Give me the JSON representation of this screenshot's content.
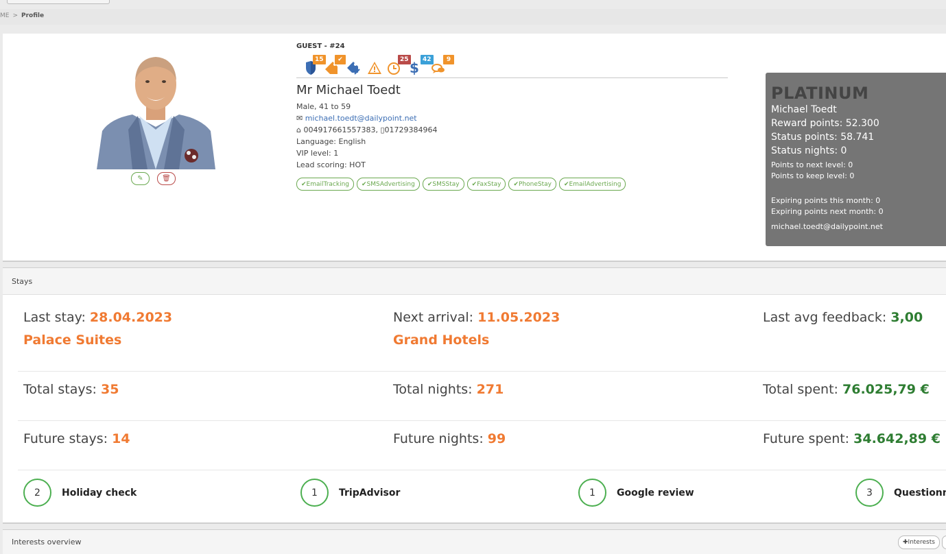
{
  "breadcrumb": {
    "home": "ME",
    "current": "Profile"
  },
  "guest": {
    "id_label": "GUEST - #24",
    "name": "Mr Michael Toedt",
    "gender_age": "Male, 41 to 59",
    "email": "michael.toedt@dailypoint.net",
    "phones": "004917661557383, ",
    "mobile": "01729384964",
    "language": "Language: English",
    "vip": "VIP level: 1",
    "lead": "Lead scoring: HOT"
  },
  "badges": [
    {
      "icon": "shield-icon",
      "count": "",
      "color": "#3c6eb4"
    },
    {
      "icon": "tag-icon",
      "count": "15",
      "color": "#f0932b"
    },
    {
      "icon": "tag-check-icon",
      "count": "✔",
      "color": "#f0932b"
    },
    {
      "icon": "tags-icon",
      "count": "",
      "color": "#3c6eb4"
    },
    {
      "icon": "warning-icon",
      "count": "",
      "color": "#f0932b"
    },
    {
      "icon": "clock-icon",
      "count": "25",
      "color": "#b94a48"
    },
    {
      "icon": "dollar-icon",
      "count": "42",
      "color": "#3aa0d8"
    },
    {
      "icon": "comments-icon",
      "count": "9",
      "color": "#f0932b"
    }
  ],
  "consents": [
    "EmailTracking",
    "SMSAdvertising",
    "SMSStay",
    "FaxStay",
    "PhoneStay",
    "EmailAdvertising"
  ],
  "loyalty": {
    "level": "PLATINUM",
    "name": "Michael Toedt",
    "reward": "Reward points: 52.300",
    "status": "Status points: 58.741",
    "nights": "Status nights: 0",
    "next_level": "Points to next level: 0",
    "keep_level": "Points to keep level: 0",
    "exp_this": "Expiring points this month: 0",
    "exp_next": "Expiring points next month: 0",
    "email": "michael.toedt@dailypoint.net"
  },
  "stays": {
    "title": "Stays",
    "last_stay_label": "Last stay: ",
    "last_stay": "28.04.2023",
    "last_hotel": "Palace Suites",
    "next_arrival_label": "Next arrival: ",
    "next_arrival": "11.05.2023",
    "next_hotel": "Grand Hotels",
    "feedback_label": "Last avg feedback: ",
    "feedback": "3,00",
    "total_stays_label": "Total stays: ",
    "total_stays": "35",
    "total_nights_label": "Total nights: ",
    "total_nights": "271",
    "total_spent_label": "Total spent: ",
    "total_spent": "76.025,79 €",
    "future_stays_label": "Future stays: ",
    "future_stays": "14",
    "future_nights_label": "Future nights: ",
    "future_nights": "99",
    "future_spent_label": "Future spent: ",
    "future_spent": "34.642,89 €"
  },
  "reviews": [
    {
      "count": "2",
      "label": "Holiday check"
    },
    {
      "count": "1",
      "label": "TripAdvisor"
    },
    {
      "count": "1",
      "label": "Google review"
    },
    {
      "count": "3",
      "label": "Questionnaire"
    }
  ],
  "interests": {
    "title": "Interests overview",
    "button": "Interests"
  },
  "colors": {
    "accent_orange": "#f07a32",
    "accent_green": "#2e7d32",
    "loyalty_bg": "#757575"
  }
}
